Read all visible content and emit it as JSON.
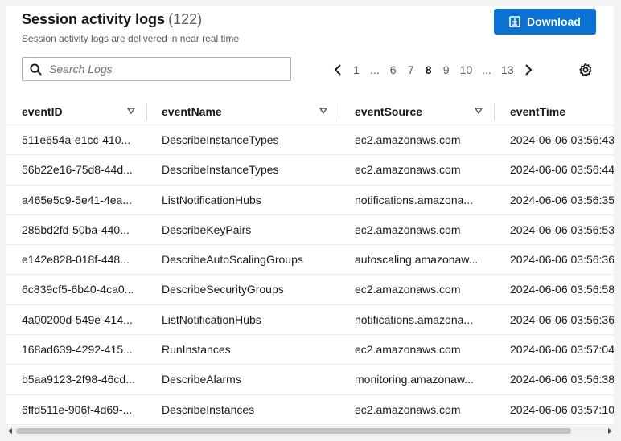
{
  "header": {
    "title": "Session activity logs",
    "count": "(122)",
    "subtitle": "Session activity logs are delivered in near real time",
    "download_label": "Download"
  },
  "search": {
    "placeholder": "Search Logs",
    "value": ""
  },
  "pagination": {
    "pages": [
      "1",
      "...",
      "6",
      "7",
      "8",
      "9",
      "10",
      "...",
      "13"
    ],
    "current": "8"
  },
  "table": {
    "columns": [
      "eventID",
      "eventName",
      "eventSource",
      "eventTime"
    ],
    "rows": [
      [
        "511e654a-e1cc-410...",
        "DescribeInstanceTypes",
        "ec2.amazonaws.com",
        "2024-06-06 03:56:43."
      ],
      [
        "56b22e16-75d8-44d...",
        "DescribeInstanceTypes",
        "ec2.amazonaws.com",
        "2024-06-06 03:56:44."
      ],
      [
        "a465e5c9-5e41-4ea...",
        "ListNotificationHubs",
        "notifications.amazona...",
        "2024-06-06 03:56:35."
      ],
      [
        "285bd2fd-50ba-440...",
        "DescribeKeyPairs",
        "ec2.amazonaws.com",
        "2024-06-06 03:56:53."
      ],
      [
        "e142e828-018f-448...",
        "DescribeAutoScalingGroups",
        "autoscaling.amazonaw...",
        "2024-06-06 03:56:36."
      ],
      [
        "6c839cf5-6b40-4ca0...",
        "DescribeSecurityGroups",
        "ec2.amazonaws.com",
        "2024-06-06 03:56:58."
      ],
      [
        "4a00200d-549e-414...",
        "ListNotificationHubs",
        "notifications.amazona...",
        "2024-06-06 03:56:36."
      ],
      [
        "168ad639-4292-415...",
        "RunInstances",
        "ec2.amazonaws.com",
        "2024-06-06 03:57:04."
      ],
      [
        "b5aa9123-2f98-46cd...",
        "DescribeAlarms",
        "monitoring.amazonaw...",
        "2024-06-06 03:56:38."
      ],
      [
        "6ffd511e-906f-4d69-...",
        "DescribeInstances",
        "ec2.amazonaws.com",
        "2024-06-06 03:57:10."
      ]
    ]
  },
  "colors": {
    "accent": "#0972d3",
    "text": "#16191f",
    "muted": "#545b64",
    "border": "#eaeded"
  },
  "icons": {
    "search": "search-icon",
    "download": "download-icon",
    "settings": "gear-icon",
    "prev": "chevron-left-icon",
    "next": "chevron-right-icon",
    "sort": "caret-down-icon"
  }
}
